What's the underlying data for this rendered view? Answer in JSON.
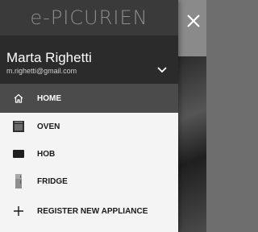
{
  "app": {
    "brand": "e-PICURIEN",
    "close_icon": "close-icon"
  },
  "account": {
    "name": "Marta Righetti",
    "email": "m.righetti@gmail.com",
    "toggle_icon": "chevron-down-icon"
  },
  "menu": {
    "items": [
      {
        "label": "HOME",
        "icon": "home-icon",
        "active": true
      },
      {
        "label": "OVEN",
        "icon": "oven-icon",
        "active": false
      },
      {
        "label": "HOB",
        "icon": "hob-icon",
        "active": false
      },
      {
        "label": "FRIDGE",
        "icon": "fridge-icon",
        "active": false
      },
      {
        "label": "REGISTER NEW APPLIANCE",
        "icon": "plus-icon",
        "active": false
      }
    ]
  },
  "colors": {
    "header_bg": "#2b2b2b",
    "active_item_bg": "#4b4b4b",
    "drawer_bg": "#f4f4f4"
  }
}
